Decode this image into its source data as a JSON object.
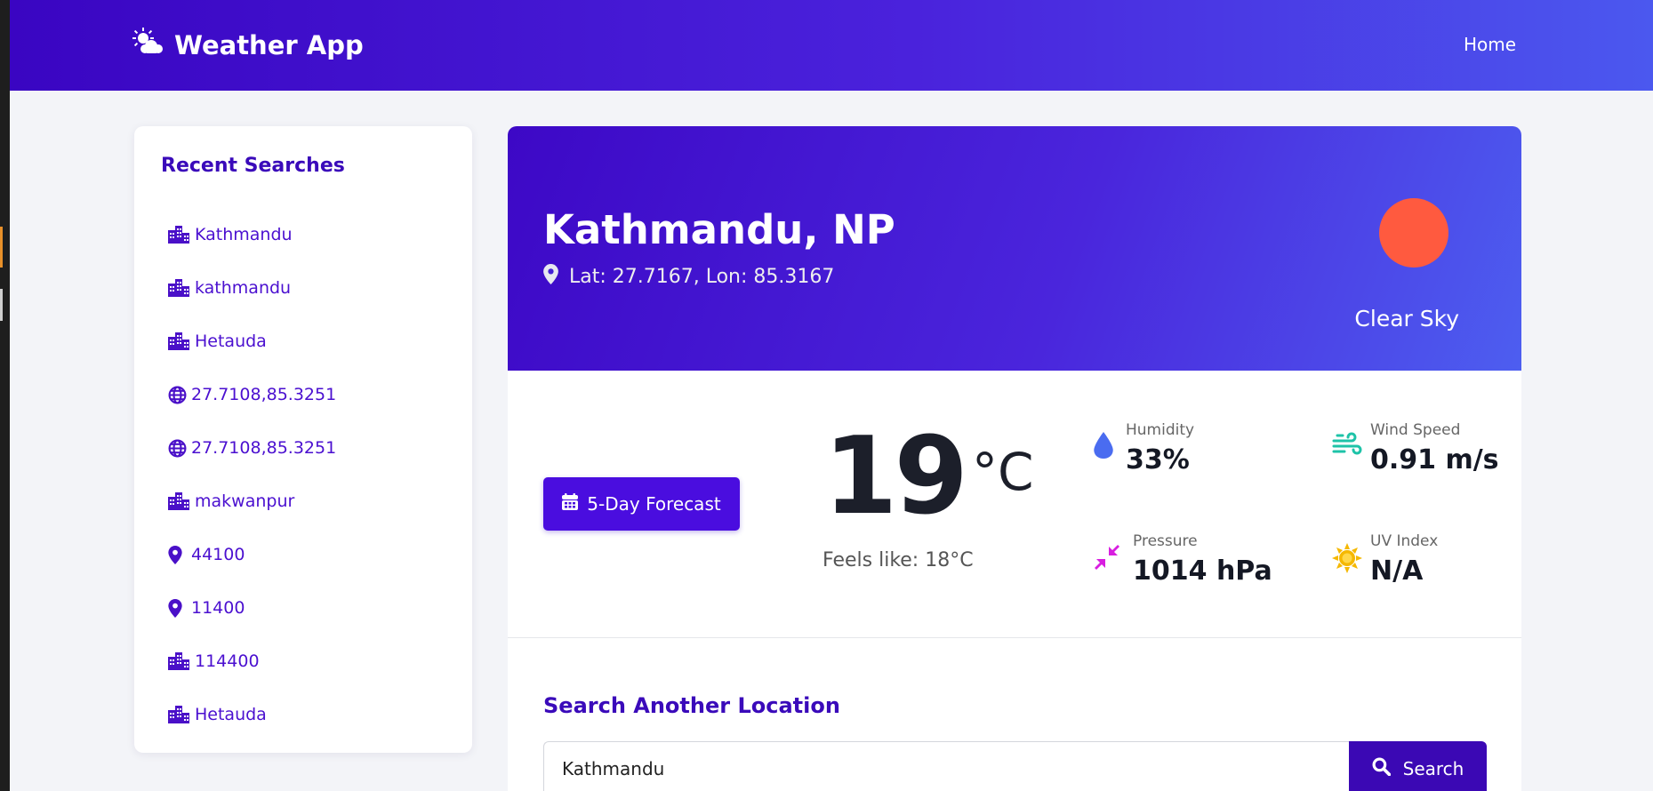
{
  "navbar": {
    "brand": "Weather App",
    "brand_icon": "cloud-sun-icon",
    "home_link": "Home"
  },
  "sidebar": {
    "title": "Recent Searches",
    "items": [
      {
        "label": "Kathmandu",
        "icon": "city-icon"
      },
      {
        "label": "kathmandu",
        "icon": "city-icon"
      },
      {
        "label": "Hetauda",
        "icon": "city-icon"
      },
      {
        "label": "27.7108,85.3251",
        "icon": "globe-icon"
      },
      {
        "label": "27.7108,85.3251",
        "icon": "globe-icon"
      },
      {
        "label": "makwanpur",
        "icon": "city-icon"
      },
      {
        "label": "44100",
        "icon": "map-pin-icon"
      },
      {
        "label": "11400",
        "icon": "map-pin-icon"
      },
      {
        "label": "114400",
        "icon": "city-icon"
      },
      {
        "label": "Hetauda",
        "icon": "city-icon"
      }
    ]
  },
  "current": {
    "city": "Kathmandu, NP",
    "coords": "Lat: 27.7167, Lon: 85.3167",
    "condition": "Clear Sky",
    "condition_icon_color": "#ff5a3f",
    "temperature": "19",
    "unit": "°C",
    "feels_like": "Feels like: 18°C",
    "forecast_button": "5-Day Forecast"
  },
  "stats": {
    "humidity": {
      "label": "Humidity",
      "value": "33%",
      "icon": "water-drop-icon",
      "color": "#4a6cf0"
    },
    "wind": {
      "label": "Wind Speed",
      "value": "0.91 m/s",
      "icon": "wind-icon",
      "color": "#1ec3a8"
    },
    "pressure": {
      "label": "Pressure",
      "value": "1014 hPa",
      "icon": "compress-arrows-icon",
      "color": "#d81ee0"
    },
    "uv": {
      "label": "UV Index",
      "value": "N/A",
      "icon": "sun-icon",
      "color": "#f5b800"
    }
  },
  "search": {
    "title": "Search Another Location",
    "input_value": "Kathmandu",
    "button_label": "Search"
  },
  "colors": {
    "primary": "#4a0ddf",
    "heading": "#3a0aba"
  }
}
